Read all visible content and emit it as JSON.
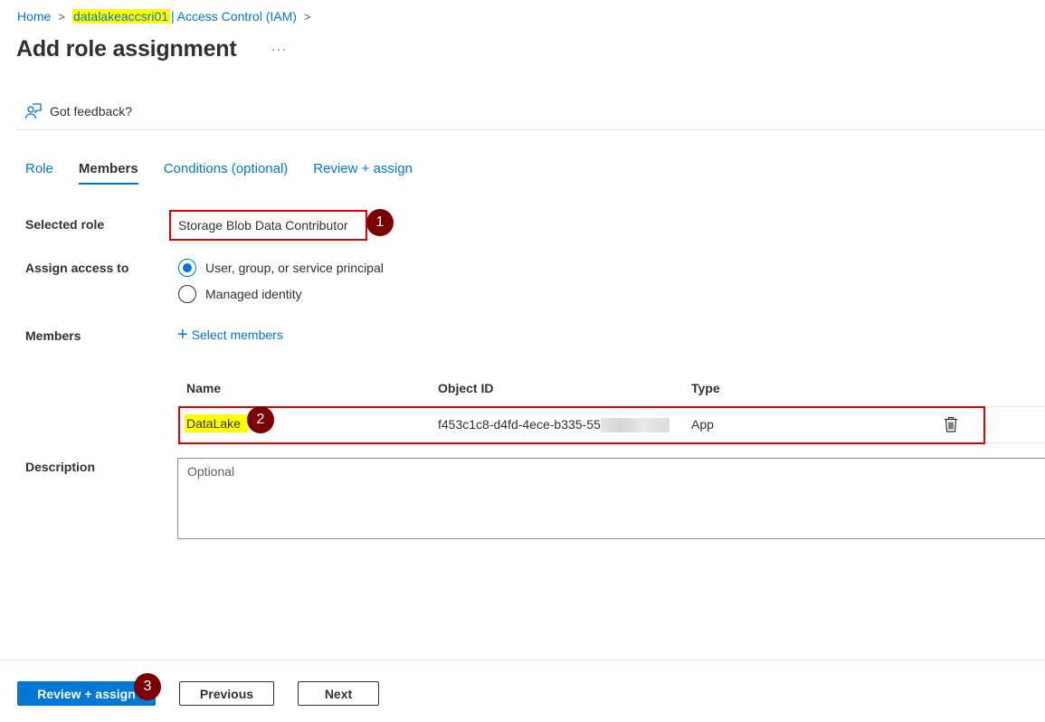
{
  "breadcrumb": {
    "home": "Home",
    "resource": "datalakeaccsri01",
    "section": "Access Control (IAM)",
    "separator": ">",
    "pipe": "|"
  },
  "header": {
    "title": "Add role assignment",
    "more_label": "···"
  },
  "feedback": {
    "label": "Got feedback?",
    "icon": "feedback-person-icon"
  },
  "tabs": [
    {
      "label": "Role",
      "active": false
    },
    {
      "label": "Members",
      "active": true
    },
    {
      "label": "Conditions (optional)",
      "active": false
    },
    {
      "label": "Review + assign",
      "active": false
    }
  ],
  "form": {
    "selected_role_label": "Selected role",
    "selected_role_value": "Storage Blob Data Contributor",
    "assign_access_label": "Assign access to",
    "assign_options": [
      {
        "label": "User, group, or service principal",
        "checked": true
      },
      {
        "label": "Managed identity",
        "checked": false
      }
    ],
    "members_label": "Members",
    "select_members_label": "Select members",
    "select_members_icon": "plus-icon",
    "description_label": "Description",
    "description_placeholder": "Optional",
    "description_value": ""
  },
  "members_table": {
    "columns": [
      "Name",
      "Object ID",
      "Type"
    ],
    "rows": [
      {
        "name": "DataLake",
        "object_id": "f453c1c8-d4fd-4ece-b335-55",
        "object_id_redacted": true,
        "type": "App",
        "action_icon": "trash-icon"
      }
    ]
  },
  "annotations": [
    {
      "number": "1",
      "target": "selected-role"
    },
    {
      "number": "2",
      "target": "member-row"
    },
    {
      "number": "3",
      "target": "review-assign-button"
    }
  ],
  "annotation_colors": {
    "badge": "#7b0000",
    "outline": "#e50000",
    "highlight": "#ffff00"
  },
  "footer": {
    "primary_label": "Review + assign",
    "previous_label": "Previous",
    "next_label": "Next"
  },
  "colors": {
    "accent": "#0078d4",
    "text": "#323130"
  }
}
